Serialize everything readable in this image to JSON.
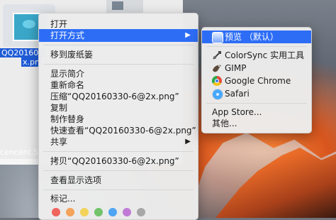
{
  "desktop": {
    "file_name_line1": "QQ201603",
    "file_name_line2": "x.pn",
    "bottom_filename": "cencent.Scree"
  },
  "context_menu": {
    "items": [
      {
        "label": "打开"
      },
      {
        "label": "打开方式",
        "has_submenu": true,
        "selected": true
      },
      {
        "label": "移到废纸篓"
      },
      {
        "label": "显示简介"
      },
      {
        "label": "重新命名"
      },
      {
        "label": "压缩“QQ20160330-6@2x.png”"
      },
      {
        "label": "复制"
      },
      {
        "label": "制作替身"
      },
      {
        "label": "快速查看“QQ20160330-6@2x.png”"
      },
      {
        "label": "共享",
        "has_submenu": true
      },
      {
        "label": "拷贝“QQ20160330-6@2x.png”"
      },
      {
        "label": "查看显示选项"
      },
      {
        "label": "标记..."
      }
    ],
    "tag_colors": [
      "#f0645c",
      "#f5a25b",
      "#f3d35a",
      "#72c36a",
      "#4da4f2",
      "#c07ad6",
      "#a7a7a7"
    ]
  },
  "submenu": {
    "items": [
      {
        "label": "预览 （默认）",
        "icon": "preview-icon",
        "selected": true
      },
      {
        "label": "ColorSync 实用工具",
        "icon": "colorsync-icon"
      },
      {
        "label": "GIMP",
        "icon": "gimp-icon"
      },
      {
        "label": "Google Chrome",
        "icon": "chrome-icon"
      },
      {
        "label": "Safari",
        "icon": "safari-icon"
      },
      {
        "label": "App Store..."
      },
      {
        "label": "其他..."
      }
    ]
  }
}
